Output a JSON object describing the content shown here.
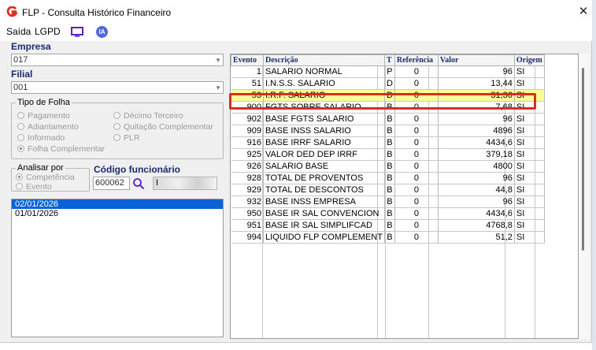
{
  "window": {
    "title": "FLP - Consulta Histórico Financeiro",
    "close_glyph": "✕"
  },
  "menu": {
    "exit": "Saída",
    "lgpd": "LGPD",
    "ia_badge": "IA"
  },
  "empresa": {
    "label": "Empresa",
    "value": "017"
  },
  "filial": {
    "label": "Filial",
    "value": "001"
  },
  "tipo_folha": {
    "title": "Tipo de Folha",
    "options": [
      "Pagamento",
      "Décimo Terceiro",
      "Adiantamento",
      "Quitação Complementar",
      "Informado",
      "PLR",
      "Folha Complementar"
    ]
  },
  "analisar": {
    "title": "Analisar por",
    "options": [
      "Competência",
      "Evento"
    ]
  },
  "funcionario": {
    "label": "Código funcionário",
    "code": "600062",
    "name_partial": "I"
  },
  "dates": [
    "02/01/2026",
    "01/01/2026"
  ],
  "grid": {
    "headers": [
      "Evento",
      "Descrição",
      "T",
      "Referência",
      "Valor",
      "Origem"
    ],
    "rows": [
      [
        "1",
        "SALARIO NORMAL",
        "P",
        "0",
        "96",
        "SI"
      ],
      [
        "51",
        "I.N.S.S. SALARIO",
        "D",
        "0",
        "13,44",
        "SI"
      ],
      [
        "53",
        "I.R.F. SALARIO",
        "D",
        "0",
        "31,36",
        "SI"
      ],
      [
        "900",
        "FGTS SOBRE SALARIO",
        "B",
        "0",
        "7,68",
        "SI"
      ],
      [
        "902",
        "BASE FGTS SALARIO",
        "B",
        "0",
        "96",
        "SI"
      ],
      [
        "909",
        "BASE INSS SALARIO",
        "B",
        "0",
        "4896",
        "SI"
      ],
      [
        "916",
        "BASE IRRF SALARIO",
        "B",
        "0",
        "4434,6",
        "SI"
      ],
      [
        "925",
        "VALOR DED DEP IRRF",
        "B",
        "0",
        "379,18",
        "SI"
      ],
      [
        "926",
        "SALARIO BASE",
        "B",
        "0",
        "4800",
        "SI"
      ],
      [
        "928",
        "TOTAL DE PROVENTOS",
        "B",
        "0",
        "96",
        "SI"
      ],
      [
        "929",
        "TOTAL DE DESCONTOS",
        "B",
        "0",
        "44,8",
        "SI"
      ],
      [
        "932",
        "BASE INSS EMPRESA",
        "B",
        "0",
        "96",
        "SI"
      ],
      [
        "950",
        "BASE IR SAL CONVENCION",
        "B",
        "0",
        "4434,6",
        "SI"
      ],
      [
        "951",
        "BASE IR SAL SIMPLIFCAD",
        "B",
        "0",
        "4768,8",
        "SI"
      ],
      [
        "994",
        "LIQUIDO FLP COMPLEMENT",
        "B",
        "0",
        "51,2",
        "SI"
      ]
    ],
    "highlighted_row_index": 2
  },
  "colors": {
    "selection_blue": "#0a63d6",
    "highlight_yellow": "#ffff99",
    "callout_red": "#d6301a",
    "label_navy": "#1a2b6d"
  }
}
